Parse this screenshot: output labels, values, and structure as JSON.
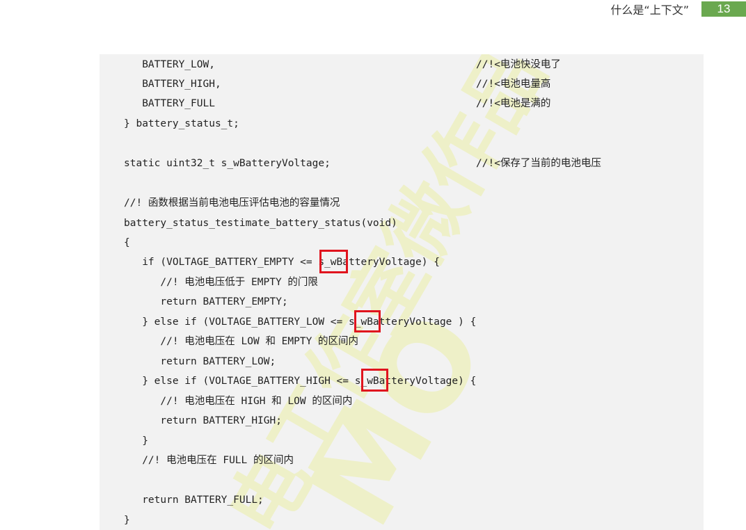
{
  "header": {
    "title": "什么是“上下文”",
    "page_number": "13"
  },
  "watermark": {
    "text": "电工作室微作品",
    "latin": "MO"
  },
  "code": {
    "lines": [
      {
        "code": "   BATTERY_LOW,",
        "comment": "//!<电池快没电了"
      },
      {
        "code": "   BATTERY_HIGH,",
        "comment": "//!<电池电量高"
      },
      {
        "code": "   BATTERY_FULL",
        "comment": "//!<电池是满的"
      },
      {
        "code": "} battery_status_t;",
        "comment": ""
      },
      {
        "code": "",
        "comment": ""
      },
      {
        "code": "static uint32_t s_wBatteryVoltage;",
        "comment": "//!<保存了当前的电池电压"
      },
      {
        "code": "",
        "comment": ""
      },
      {
        "code": "//! 函数根据当前电池电压评估电池的容量情况",
        "comment": ""
      },
      {
        "code": "battery_status_testimate_battery_status(void)",
        "comment": ""
      },
      {
        "code": "{",
        "comment": ""
      },
      {
        "code": "   if (VOLTAGE_BATTERY_EMPTY <= s_wBatteryVoltage) {",
        "comment": ""
      },
      {
        "code": "      //! 电池电压低于 EMPTY 的门限",
        "comment": ""
      },
      {
        "code": "      return BATTERY_EMPTY;",
        "comment": ""
      },
      {
        "code": "   } else if (VOLTAGE_BATTERY_LOW <= s_wBatteryVoltage ) {",
        "comment": ""
      },
      {
        "code": "      //! 电池电压在 LOW 和 EMPTY 的区间内",
        "comment": ""
      },
      {
        "code": "      return BATTERY_LOW;",
        "comment": ""
      },
      {
        "code": "   } else if (VOLTAGE_BATTERY_HIGH <= s_wBatteryVoltage) {",
        "comment": ""
      },
      {
        "code": "      //! 电池电压在 HIGH 和 LOW 的区间内",
        "comment": ""
      },
      {
        "code": "      return BATTERY_HIGH;",
        "comment": ""
      },
      {
        "code": "   }",
        "comment": ""
      },
      {
        "code": "   //! 电池电压在 FULL 的区间内",
        "comment": ""
      },
      {
        "code": "",
        "comment": ""
      },
      {
        "code": "   return BATTERY_FULL;",
        "comment": ""
      },
      {
        "code": "}",
        "comment": ""
      }
    ]
  }
}
